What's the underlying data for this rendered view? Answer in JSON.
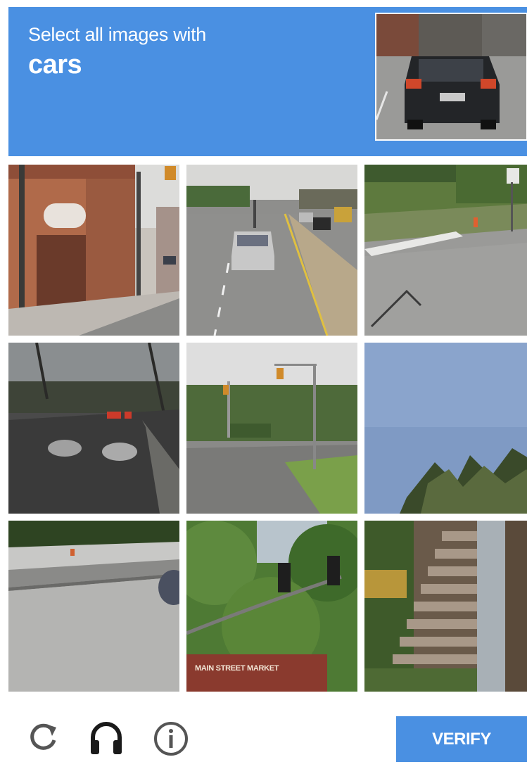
{
  "header": {
    "instruction": "Select all images with",
    "target": "cars",
    "accent_color": "#4a90e2"
  },
  "grid": {
    "rows": 3,
    "cols": 3,
    "tiles": [
      {
        "scene": "brick storefront with traffic light pole and sidewalk"
      },
      {
        "scene": "multi-lane road with silver car approaching"
      },
      {
        "scene": "intersection with crosswalk and road sign"
      },
      {
        "scene": "divided highway with cars in overcast weather"
      },
      {
        "scene": "intersection with traffic lights and grass median"
      },
      {
        "scene": "sky with pine tree tops"
      },
      {
        "scene": "road edge with barrier and partial car"
      },
      {
        "scene": "traffic lights among green trees and market sign"
      },
      {
        "scene": "outdoor stone staircase with metal post"
      }
    ],
    "market_sign_text": "MAIN STREET MARKET"
  },
  "footer": {
    "icons": [
      "reload-icon",
      "audio-icon",
      "info-icon"
    ],
    "verify_label": "VERIFY"
  }
}
